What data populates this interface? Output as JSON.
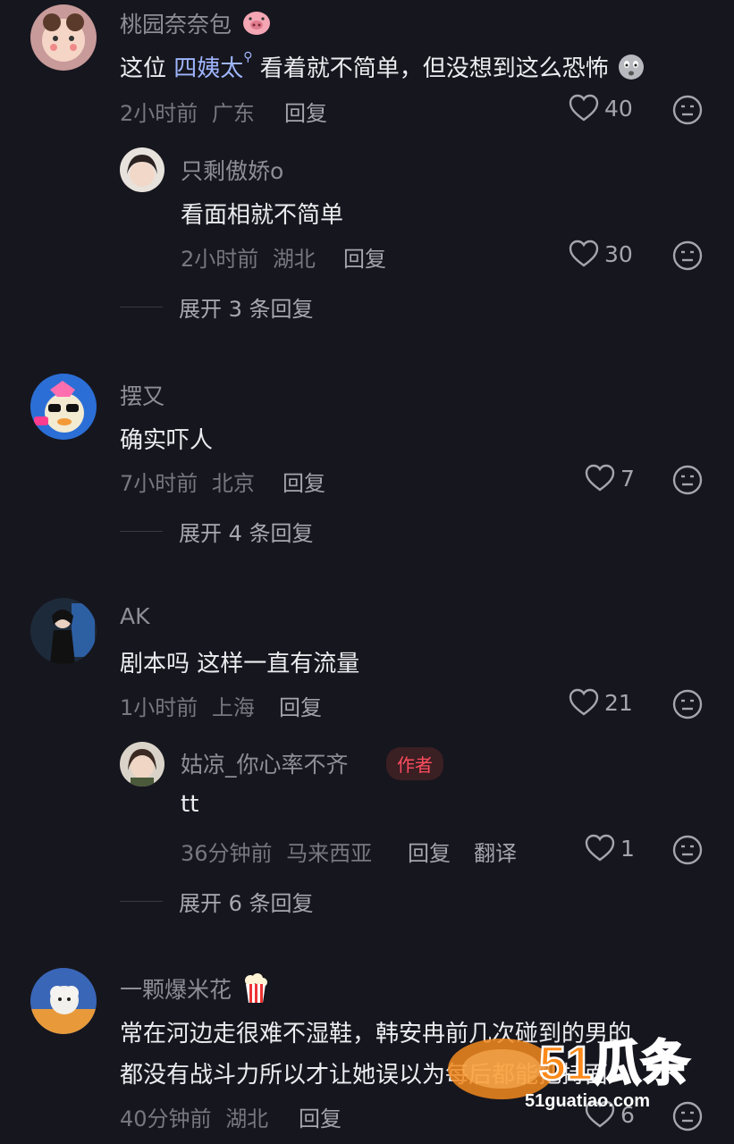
{
  "colors": {
    "background": "#16161e",
    "link": "#9fb6ff",
    "author_badge": "#ff4d5e"
  },
  "comments": [
    {
      "user": "桃园奈奈包",
      "user_emoji": "pig-face-emoji",
      "text_pre": "这位 ",
      "text_link": "四姨太",
      "text_post": " 看着就不简单，但没想到这么恐怖",
      "text_emoji": "shocked-face-emoji",
      "time": "2小时前",
      "location": "广东",
      "reply": "回复",
      "likes": "40",
      "replies": [
        {
          "user": "只剩傲娇o",
          "text": "看面相就不简单",
          "time": "2小时前",
          "location": "湖北",
          "reply": "回复",
          "likes": "30"
        }
      ],
      "expand": "展开 3 条回复"
    },
    {
      "user": "摆又",
      "text": "确实吓人",
      "time": "7小时前",
      "location": "北京",
      "reply": "回复",
      "likes": "7",
      "expand": "展开 4 条回复"
    },
    {
      "user": "AK",
      "text": "剧本吗 这样一直有流量",
      "time": "1小时前",
      "location": "上海",
      "reply": "回复",
      "likes": "21",
      "replies": [
        {
          "user": "姑凉_你心率不齐",
          "badge": "作者",
          "text": "tt",
          "time": "36分钟前",
          "location": "马来西亚",
          "reply": "回复",
          "translate": "翻译",
          "likes": "1"
        }
      ],
      "expand": "展开 6 条回复"
    },
    {
      "user": "一颗爆米花",
      "user_emoji": "popcorn-emoji",
      "text_line1": "常在河边走很难不湿鞋，韩安冉前几次碰到的男的",
      "text_line2": "都没有战斗力所以才让她误以为每后都能把持面",
      "time": "40分钟前",
      "location": "湖北",
      "reply": "回复",
      "likes": "6"
    }
  ],
  "watermark": {
    "brand": "51瓜条",
    "url": "51guatiao.com"
  }
}
